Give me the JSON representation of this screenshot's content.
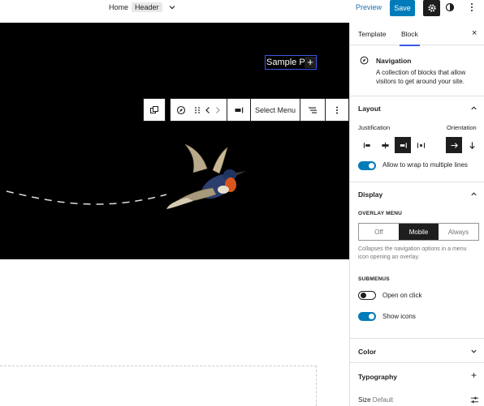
{
  "topbar": {
    "breadcrumb_home": "Home",
    "breadcrumb_tag": "Header",
    "preview_label": "Preview",
    "save_label": "Save"
  },
  "canvas": {
    "nav_item_text": "Sample Pa",
    "add_icon": "+"
  },
  "block_toolbar": {
    "select_menu_label": "Select Menu"
  },
  "sidebar": {
    "tabs": [
      {
        "label": "Template"
      },
      {
        "label": "Block",
        "active": true
      }
    ],
    "close_icon": "×",
    "block": {
      "title": "Navigation",
      "description": "A collection of blocks that allow visitors to get around your site."
    },
    "layout": {
      "title": "Layout",
      "justification_label": "Justification",
      "orientation_label": "Orientation",
      "wrap_label": "Allow to wrap to multiple lines",
      "wrap_enabled": true
    },
    "display": {
      "title": "Display",
      "overlay_menu_label": "Overlay Menu",
      "overlay_options": [
        "Off",
        "Mobile",
        "Always"
      ],
      "overlay_selected": "Mobile",
      "overlay_help": "Collapses the navigation options in a menu icon opening an overlay.",
      "submenus_label": "Submenus",
      "open_on_click_label": "Open on click",
      "open_on_click": false,
      "show_icons_label": "Show icons",
      "show_icons": true
    },
    "color": {
      "title": "Color"
    },
    "typography": {
      "title": "Typography",
      "add_icon": "+",
      "size_label": "Size",
      "size_value": "Default"
    }
  },
  "colors": {
    "accent": "#007cba",
    "selection": "#3858e9",
    "dark": "#1e1e1e"
  }
}
